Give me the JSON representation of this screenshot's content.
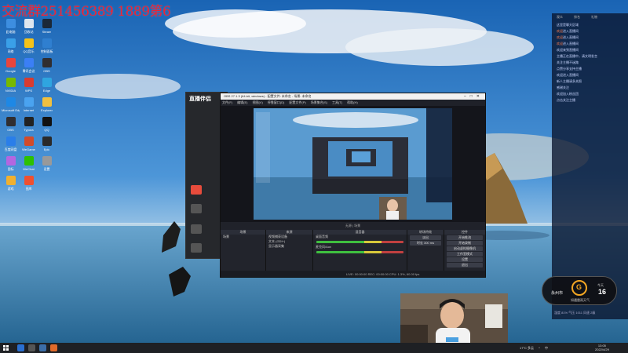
{
  "overlay": {
    "caption": "交流群251456389 1889第6"
  },
  "desktop_icons": [
    {
      "label": "此电脑",
      "color": "#3d8ee0"
    },
    {
      "label": "回收站",
      "color": "#dfe6ee"
    },
    {
      "label": "Steam",
      "color": "#1b2838"
    },
    {
      "label": "网络",
      "color": "#3aa0e8"
    },
    {
      "label": "QQ音乐",
      "color": "#f4c21a"
    },
    {
      "label": "控制面板",
      "color": "#2f7fd0"
    },
    {
      "label": "Google",
      "color": "#e8453c"
    },
    {
      "label": "腾讯会议",
      "color": "#3b7ff6"
    },
    {
      "label": "OBS",
      "color": "#302e31"
    },
    {
      "label": "NVIDIA",
      "color": "#76b900"
    },
    {
      "label": "WPS",
      "color": "#d83b2f"
    },
    {
      "label": "Edge",
      "color": "#2fa5e0"
    },
    {
      "label": "Microsoft Edge",
      "color": "#1e88e5"
    },
    {
      "label": "Internet",
      "color": "#4aa3f0"
    },
    {
      "label": "Explorer",
      "color": "#f0c040"
    },
    {
      "label": "OBS",
      "color": "#302e31"
    },
    {
      "label": "Typora",
      "color": "#222"
    },
    {
      "label": "QQ",
      "color": "#111"
    },
    {
      "label": "百度网盘",
      "color": "#2a7ee9"
    },
    {
      "label": "WeGame",
      "color": "#d24b2a"
    },
    {
      "label": "Epic",
      "color": "#2a2a2a"
    },
    {
      "label": "图标",
      "color": "#b466e0"
    },
    {
      "label": "WeChat",
      "color": "#2dc100"
    },
    {
      "label": "设置",
      "color": "#999"
    },
    {
      "label": "游戏",
      "color": "#f0b030"
    },
    {
      "label": "图库",
      "color": "#f05030"
    }
  ],
  "live_app": {
    "brand": "直播伴侣"
  },
  "obs": {
    "title": "OBS 27.1.3 (64-bit, windows) - 配置文件: 未命名 - 场景: 未命名",
    "menu": [
      "文件(F)",
      "编辑(E)",
      "视图(V)",
      "停靠窗口(D)",
      "配置文件(P)",
      "场景集合(S)",
      "工具(T)",
      "帮助(H)"
    ],
    "scene_bar": "无源 | 场景",
    "docks": {
      "scenes": {
        "header": "场景",
        "items": [
          "场景"
        ]
      },
      "sources": {
        "header": "来源",
        "items": [
          "视频捕获设备",
          "文本 (GDI+)",
          "显示器采集"
        ]
      },
      "mixer": {
        "header": "混音器",
        "items": [
          "桌面音频",
          "麦克风/Aux"
        ]
      },
      "transitions": {
        "header": "转场特效",
        "items": [
          "淡出",
          "时长 300 ms"
        ]
      },
      "controls": {
        "header": "控件",
        "buttons": [
          "开始推流",
          "开始录制",
          "启动虚拟摄像机",
          "工作室模式",
          "设置",
          "退出"
        ]
      }
    },
    "status": "LIVE: 00:00:00   REC: 00:00:00   CPU: 1.3%, 60.00 fps"
  },
  "chat": {
    "top": [
      "观众",
      "排名",
      "礼物"
    ],
    "messages": [
      {
        "name": "",
        "text": "这里是聊天区域"
      },
      {
        "name": "欢迎",
        "text": "进入直播间"
      },
      {
        "name": "欢迎",
        "text": "进入直播间"
      },
      {
        "name": "欢迎",
        "text": "进入直播间"
      },
      {
        "name": "",
        "text": "欢迎来到直播间"
      },
      {
        "name": "",
        "text": "主播正在直播中，请文明发言"
      },
      {
        "name": "",
        "text": "关注主播不迷路"
      },
      {
        "name": "",
        "text": "点赞分享支持主播"
      },
      {
        "name": "",
        "text": "欢迎进入直播间"
      },
      {
        "name": "",
        "text": "新人主播请多关照"
      },
      {
        "name": "",
        "text": "感谢关注"
      },
      {
        "name": "",
        "text": "欢迎加入粉丝团"
      },
      {
        "name": "",
        "text": "点击关注主播"
      }
    ]
  },
  "weather": {
    "left": "永州市",
    "right_label": "今天",
    "right_value": "16",
    "subtitle": "如遇雷雨天气",
    "stats": "湿度 81%  气压 1011  风速 2级"
  },
  "taskbar": {
    "tray": [
      "17°C 多云",
      "^",
      "中"
    ],
    "time": "13:05",
    "date": "2022/4/29"
  }
}
